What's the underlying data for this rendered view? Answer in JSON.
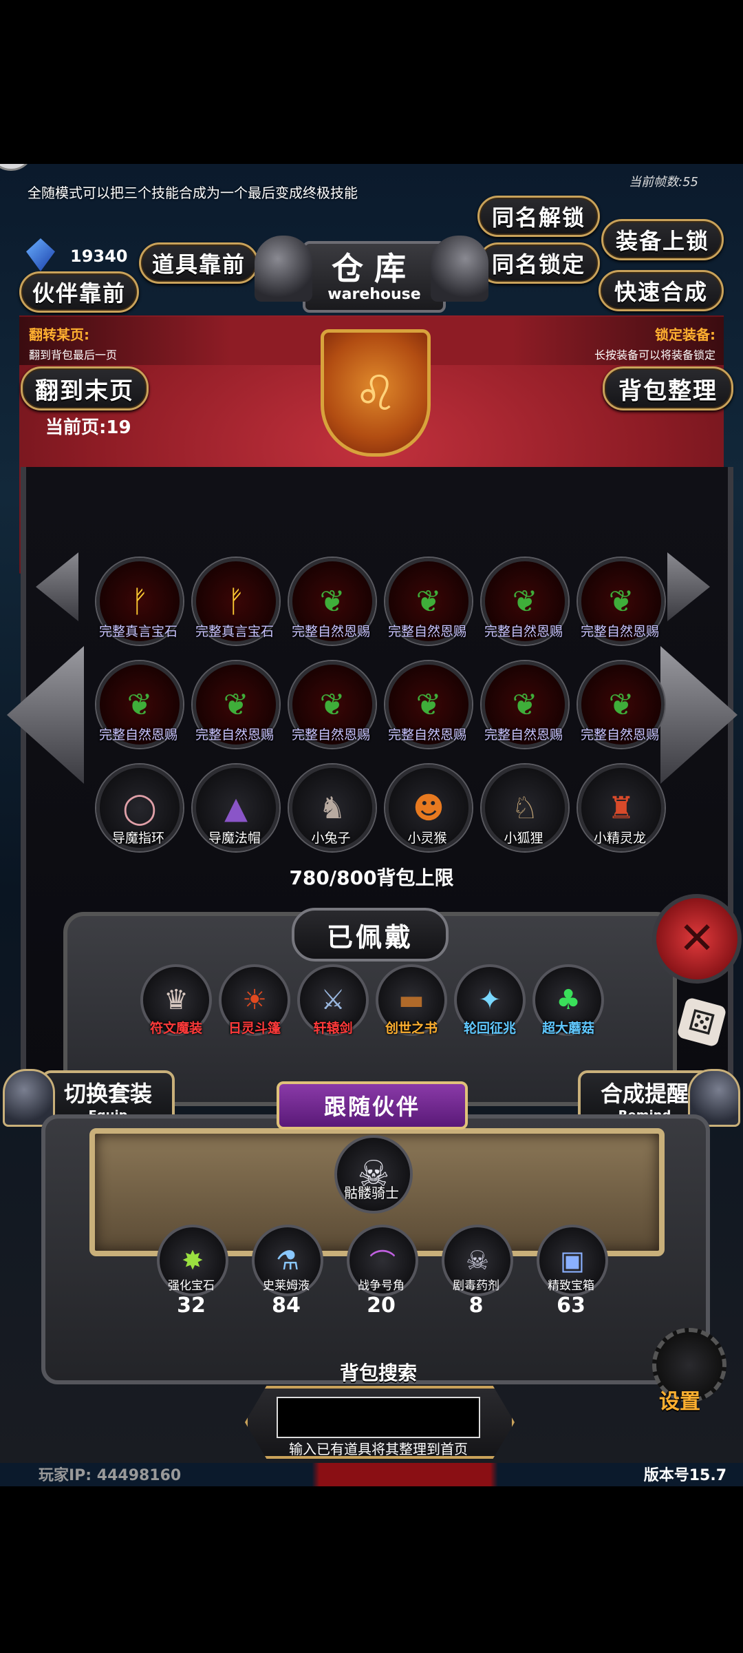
{
  "tip": "全随模式可以把三个技能合成为一个最后变成终极技能",
  "fps_label": "当前帧数:55",
  "currency_value": "19340",
  "buttons": {
    "same_unlock": "同名解锁",
    "equip_lock": "装备上锁",
    "items_front": "道具靠前",
    "same_lock": "同名锁定",
    "partner_front": "伙伴靠前",
    "quick_merge": "快速合成",
    "to_last_page": "翻到末页",
    "bag_sort": "背包整理"
  },
  "warehouse": {
    "title_cn": "仓库",
    "title_en": "warehouse"
  },
  "hints": {
    "flip_title": "翻转某页:",
    "flip_desc": "翻到背包最后一页",
    "lock_title": "锁定装备:",
    "lock_desc": "长按装备可以将装备锁定"
  },
  "current_page": "当前页:19",
  "items": [
    {
      "label": "完整真言宝石",
      "icon": "rune-gem-icon",
      "glyph": "ᚠ",
      "color": "#ffcc33",
      "style": "red"
    },
    {
      "label": "完整真言宝石",
      "icon": "rune-gem-icon",
      "glyph": "ᚠ",
      "color": "#ffcc33",
      "style": "red"
    },
    {
      "label": "完整自然恩赐",
      "icon": "green-leaf-icon",
      "glyph": "❦",
      "color": "#3fae3a",
      "style": "red"
    },
    {
      "label": "完整自然恩赐",
      "icon": "green-leaf-icon",
      "glyph": "❦",
      "color": "#3fae3a",
      "style": "red"
    },
    {
      "label": "完整自然恩赐",
      "icon": "green-leaf-icon",
      "glyph": "❦",
      "color": "#3fae3a",
      "style": "red"
    },
    {
      "label": "完整自然恩赐",
      "icon": "green-leaf-icon",
      "glyph": "❦",
      "color": "#3fae3a",
      "style": "red"
    },
    {
      "label": "完整自然恩赐",
      "icon": "green-leaf-icon",
      "glyph": "❦",
      "color": "#3fae3a",
      "style": "red"
    },
    {
      "label": "完整自然恩赐",
      "icon": "green-leaf-icon",
      "glyph": "❦",
      "color": "#3fae3a",
      "style": "red"
    },
    {
      "label": "完整自然恩赐",
      "icon": "green-leaf-icon",
      "glyph": "❦",
      "color": "#3fae3a",
      "style": "red"
    },
    {
      "label": "完整自然恩赐",
      "icon": "green-leaf-icon",
      "glyph": "❦",
      "color": "#3fae3a",
      "style": "red"
    },
    {
      "label": "完整自然恩赐",
      "icon": "green-leaf-icon",
      "glyph": "❦",
      "color": "#3fae3a",
      "style": "red"
    },
    {
      "label": "完整自然恩赐",
      "icon": "green-leaf-icon",
      "glyph": "❦",
      "color": "#3fae3a",
      "style": "red"
    },
    {
      "label": "导魔指环",
      "icon": "ring-icon",
      "glyph": "◯",
      "color": "#e0a0a8",
      "style": "dark"
    },
    {
      "label": "导魔法帽",
      "icon": "wizard-hat-icon",
      "glyph": "▲",
      "color": "#8a55c8",
      "style": "dark"
    },
    {
      "label": "小兔子",
      "icon": "rabbit-icon",
      "glyph": "♞",
      "color": "#b8aaa0",
      "style": "dark"
    },
    {
      "label": "小灵猴",
      "icon": "monkey-icon",
      "glyph": "☻",
      "color": "#e87a20",
      "style": "dark"
    },
    {
      "label": "小狐狸",
      "icon": "fox-icon",
      "glyph": "♘",
      "color": "#c8a878",
      "style": "dark"
    },
    {
      "label": "小精灵龙",
      "icon": "dragon-icon",
      "glyph": "♜",
      "color": "#d84a2a",
      "style": "dark"
    }
  ],
  "capacity": "780/800背包上限",
  "equipped": {
    "title": "已佩戴",
    "items": [
      {
        "label": "符文魔装",
        "icon": "rune-armor-icon",
        "glyph": "♛",
        "color": "#d8c8c0",
        "label_color": "#ff3a3a"
      },
      {
        "label": "日灵斗篷",
        "icon": "cloak-icon",
        "glyph": "☀",
        "color": "#e04a20",
        "label_color": "#ff3a3a"
      },
      {
        "label": "轩辕剑",
        "icon": "sword-icon",
        "glyph": "⚔",
        "color": "#9ab8e0",
        "label_color": "#ff3a3a"
      },
      {
        "label": "创世之书",
        "icon": "book-icon",
        "glyph": "▬",
        "color": "#b06a2a",
        "label_color": "#ffb030"
      },
      {
        "label": "轮回征兆",
        "icon": "crystal-staff-icon",
        "glyph": "✦",
        "color": "#7ad8ff",
        "label_color": "#60c8ff"
      },
      {
        "label": "超大蘑菇",
        "icon": "mushroom-icon",
        "glyph": "♣",
        "color": "#3ae05a",
        "label_color": "#60c8ff"
      }
    ]
  },
  "switch_suit": {
    "cn": "切换套装",
    "en": "Equip"
  },
  "merge_remind": {
    "cn": "合成提醒",
    "en": "Remind"
  },
  "partner": {
    "title": "跟随伙伴",
    "name": "骷髅骑士",
    "icon": "skeleton-knight-icon",
    "glyph": "☠"
  },
  "materials": [
    {
      "label": "强化宝石",
      "count": "32",
      "icon": "green-gem-icon",
      "glyph": "✸",
      "color": "#9ae040"
    },
    {
      "label": "史莱姆液",
      "count": "84",
      "icon": "potion-icon",
      "glyph": "⚗",
      "color": "#8ac8ff"
    },
    {
      "label": "战争号角",
      "count": "20",
      "icon": "horn-icon",
      "glyph": "⌒",
      "color": "#c060e0"
    },
    {
      "label": "剧毒药剂",
      "count": "8",
      "icon": "poison-bottle-icon",
      "glyph": "☠",
      "color": "#c8c8d8"
    },
    {
      "label": "精致宝箱",
      "count": "63",
      "icon": "chest-icon",
      "glyph": "▣",
      "color": "#8ab0ff"
    }
  ],
  "search": {
    "title": "背包搜索",
    "placeholder": "",
    "hint": "输入已有道具将其整理到首页"
  },
  "settings_label": "设置",
  "player_ip": "玩家IP: 44498160",
  "version": "版本号15.7",
  "colors": {
    "accent_gold": "#c9a25a",
    "banner_red": "#8e1c25",
    "close_red": "#c0282c"
  }
}
